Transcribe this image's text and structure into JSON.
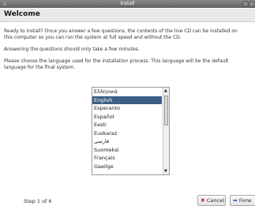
{
  "window": {
    "title": "Install",
    "menu_glyph": "▫"
  },
  "page": {
    "heading": "Welcome",
    "paragraphs": [
      "Ready to install? Once you answer a few questions, the contents of the live CD can be installed on this computer so you can run the system at full speed and without the CD.",
      "Answering the questions should only take a few minutes.",
      "Please choose the language used for the installation process. This language will be the default language for the final system."
    ]
  },
  "languages": {
    "items": [
      "Ελληνικά",
      "English",
      "Esperanto",
      "Español",
      "Eesti",
      "Euskaraz",
      "فارسی",
      "Suomeksi",
      "Français",
      "Gaeilge"
    ],
    "selected": "English"
  },
  "footer": {
    "step": "Step 1 of 6",
    "cancel_label": "Cancel",
    "forward_label": "Forw"
  }
}
